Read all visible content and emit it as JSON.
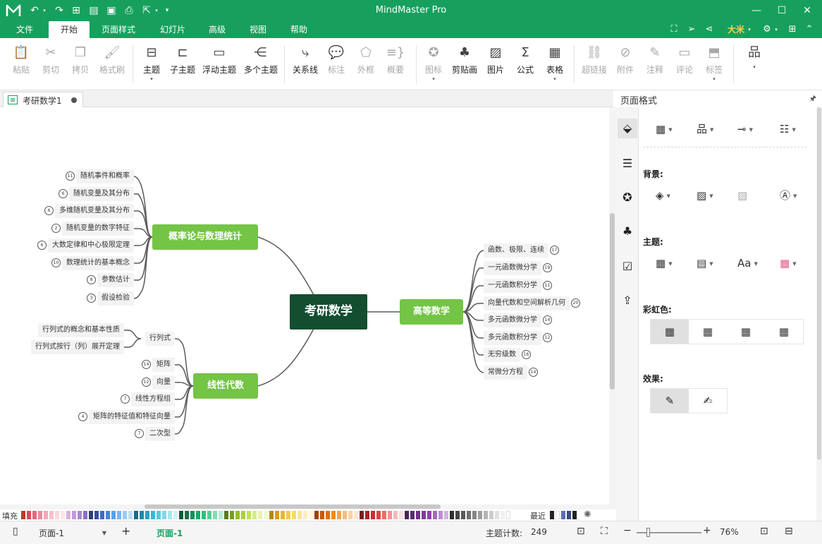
{
  "titlebar": {
    "title": "MindMaster Pro",
    "quick_access_icons": [
      "undo-icon",
      "redo-icon",
      "new-icon",
      "open-icon",
      "save-icon",
      "print-icon",
      "export-icon"
    ],
    "window_controls": {
      "minimize": "—",
      "maximize": "☐",
      "close": "✕"
    }
  },
  "menubar": {
    "items": [
      "文件",
      "开始",
      "页面样式",
      "幻灯片",
      "高级",
      "视图",
      "帮助"
    ],
    "active": "开始",
    "user": "大米"
  },
  "ribbon": {
    "buttons": [
      {
        "label": "粘贴",
        "icon": "paste-icon",
        "enabled": false
      },
      {
        "label": "剪切",
        "icon": "cut-icon",
        "enabled": false
      },
      {
        "label": "拷贝",
        "icon": "copy-icon",
        "enabled": false
      },
      {
        "label": "格式刷",
        "icon": "format-painter-icon",
        "enabled": false
      },
      {
        "label": "主题",
        "icon": "topic-icon",
        "enabled": true
      },
      {
        "label": "子主题",
        "icon": "subtopic-icon",
        "enabled": true
      },
      {
        "label": "浮动主题",
        "icon": "floating-topic-icon",
        "enabled": true
      },
      {
        "label": "多个主题",
        "icon": "multiple-topics-icon",
        "enabled": true
      },
      {
        "label": "关系线",
        "icon": "relationship-icon",
        "enabled": true
      },
      {
        "label": "标注",
        "icon": "callout-icon",
        "enabled": false
      },
      {
        "label": "外框",
        "icon": "boundary-icon",
        "enabled": false
      },
      {
        "label": "概要",
        "icon": "summary-icon",
        "enabled": false
      },
      {
        "label": "图标",
        "icon": "mark-icon",
        "enabled": false
      },
      {
        "label": "剪贴画",
        "icon": "clipart-icon",
        "enabled": true
      },
      {
        "label": "图片",
        "icon": "picture-icon",
        "enabled": true
      },
      {
        "label": "公式",
        "icon": "formula-icon",
        "enabled": true
      },
      {
        "label": "表格",
        "icon": "table-icon",
        "enabled": true
      },
      {
        "label": "超链接",
        "icon": "hyperlink-icon",
        "enabled": false
      },
      {
        "label": "附件",
        "icon": "attachment-icon",
        "enabled": false
      },
      {
        "label": "注释",
        "icon": "note-icon",
        "enabled": false
      },
      {
        "label": "评论",
        "icon": "comment-icon",
        "enabled": false
      },
      {
        "label": "标签",
        "icon": "tag-icon",
        "enabled": false
      }
    ]
  },
  "document": {
    "tab_name": "考研数学1"
  },
  "mindmap": {
    "central": "考研数学",
    "branches": [
      {
        "name": "概率论与数理统计",
        "children": [
          {
            "label": "随机事件和概率",
            "badge": "11"
          },
          {
            "label": "随机变量及其分布",
            "badge": "6"
          },
          {
            "label": "多维随机变量及其分布",
            "badge": "6"
          },
          {
            "label": "随机变量的数字特征",
            "badge": "2"
          },
          {
            "label": "大数定律和中心极限定理",
            "badge": "6"
          },
          {
            "label": "数理统计的基本概念",
            "badge": "10"
          },
          {
            "label": "参数估计",
            "badge": "8"
          },
          {
            "label": "假设检验",
            "badge": "3"
          }
        ]
      },
      {
        "name": "高等数学",
        "children": [
          {
            "label": "函数、极限、连续",
            "badge": "17"
          },
          {
            "label": "一元函数微分学",
            "badge": "19"
          },
          {
            "label": "一元函数积分学",
            "badge": "11"
          },
          {
            "label": "向量代数和空间解析几何",
            "badge": "20"
          },
          {
            "label": "多元函数微分学",
            "badge": "14"
          },
          {
            "label": "多元函数积分学",
            "badge": "12"
          },
          {
            "label": "无穷级数",
            "badge": "16"
          },
          {
            "label": "常微分方程",
            "badge": "14"
          }
        ]
      },
      {
        "name": "线性代数",
        "children": [
          {
            "label": "行列式",
            "badge": "",
            "children": [
              "行列式的概念和基本性质",
              "行列式按行（列）展开定理"
            ]
          },
          {
            "label": "矩阵",
            "badge": "14"
          },
          {
            "label": "向量",
            "badge": "12"
          },
          {
            "label": "线性方程组",
            "badge": "7"
          },
          {
            "label": "矩阵的特征值和特征向量",
            "badge": "4"
          },
          {
            "label": "二次型",
            "badge": "7"
          }
        ]
      }
    ]
  },
  "panel": {
    "title": "页面格式",
    "sections": {
      "background": "背景:",
      "theme": "主题:",
      "rainbow": "彩虹色:",
      "effect": "效果:"
    },
    "side_icons": [
      "page-format-icon",
      "outline-icon",
      "mark-icon",
      "clipart-icon",
      "task-icon",
      "export-icon"
    ]
  },
  "palette": {
    "label": "填充",
    "recent_label": "最近",
    "colors": [
      "#c0392b",
      "#d94c5b",
      "#e5677a",
      "#ef8a9a",
      "#f4a7b5",
      "#f7c1cc",
      "#fad6de",
      "#fbe5ea",
      "#d7b2d8",
      "#c39bd3",
      "#a78bc9",
      "#8e6fbf",
      "#2c3e7a",
      "#34509a",
      "#3f6cbb",
      "#4a86d6",
      "#5aa0e8",
      "#79b6ef",
      "#9ccbf3",
      "#bcdff8",
      "#1a6b8c",
      "#1f88a8",
      "#27a3c4",
      "#3ab8d8",
      "#5cc7e1",
      "#84d6ea",
      "#a9e3f1",
      "#d1f1f8",
      "#0e5a3a",
      "#127348",
      "#179058",
      "#1ca96a",
      "#2fbe7e",
      "#59cc98",
      "#86dbb5",
      "#b5ead1",
      "#5a7d1a",
      "#76a020",
      "#93c02a",
      "#abd13a",
      "#c2df5b",
      "#d6ea85",
      "#e6f2ae",
      "#f1f8d3",
      "#b8860b",
      "#d4a017",
      "#e6b82d",
      "#f2ca47",
      "#f7da6c",
      "#fae595",
      "#fcefbc",
      "#fdf7df",
      "#a04000",
      "#c85a00",
      "#e07000",
      "#f08a1e",
      "#f5a449",
      "#f8bd75",
      "#fbd3a2",
      "#fde7cd",
      "#7f1d1d",
      "#a32727",
      "#c63131",
      "#e04343",
      "#eb6b6b",
      "#f19494",
      "#f6bcbc",
      "#fadfdf",
      "#4a235a",
      "#5b2c6f",
      "#6c3483",
      "#7d3c98",
      "#8e44ad",
      "#a569bd",
      "#bb8fce",
      "#d2b4de",
      "#2e2e2e",
      "#444444",
      "#5a5a5a",
      "#707070",
      "#878787",
      "#9e9e9e",
      "#b5b5b5",
      "#cccccc",
      "#e0e0e0",
      "#f0f0f0",
      "#ffffff"
    ],
    "recent": [
      "#222222",
      "#ffffff",
      "#5b6fb5",
      "#3b4a8a",
      "#222222"
    ]
  },
  "status": {
    "page_selector": "页面-1",
    "current_page_tab": "页面-1",
    "topic_count_label": "主题计数:",
    "topic_count": "249",
    "zoom": "76%"
  }
}
